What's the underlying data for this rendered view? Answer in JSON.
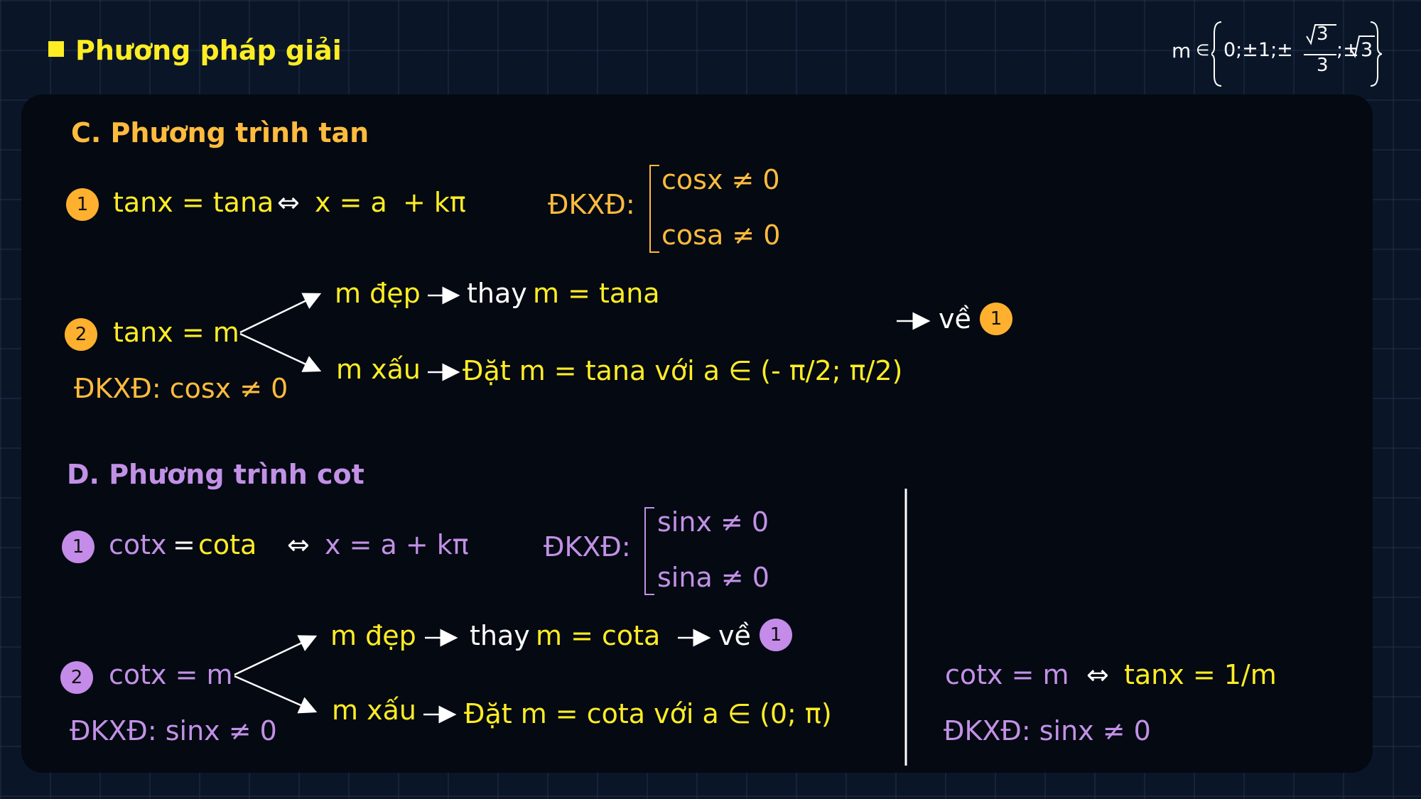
{
  "header": {
    "title": "Phương pháp giải",
    "m_set": {
      "m": "m",
      "in": "∈",
      "lead": "0;±1;±",
      "sqrt3": "3",
      "denom": "3",
      "tail": ";±",
      "sqrt3b": "3"
    }
  },
  "tan": {
    "heading": "C. Phương trình tan",
    "eq1": {
      "badge": "1",
      "lhs": "tanx = tana",
      "iff": "⇔",
      "x": "x = a",
      "k": "+ kπ"
    },
    "dk1": {
      "label": "ĐKXĐ:",
      "c1": "cosx ≠ 0",
      "c2": "cosa ≠ 0"
    },
    "eq2": {
      "badge": "2",
      "lhs": "tanx = m",
      "dk": "ĐKXĐ: cosx ≠ 0"
    },
    "nice": {
      "label": "m đẹp",
      "thay": "thay",
      "val": "m = tana"
    },
    "ugly": {
      "label": "m xấu",
      "text": "Đặt m = tana với a ∈ (- π/2; π/2)"
    },
    "back": {
      "text": "về",
      "badge": "1"
    }
  },
  "cot": {
    "heading": "D. Phương trình cot",
    "eq1": {
      "badge": "1",
      "lhs_fn": "cotx",
      "lhs_eq": "=",
      "lhs_rhs": "cota",
      "iff": "⇔",
      "x": "x = a + kπ"
    },
    "dk1": {
      "label": "ĐKXĐ:",
      "c1": "sinx ≠ 0",
      "c2": "sina ≠ 0"
    },
    "eq2": {
      "badge": "2",
      "lhs": "cotx = m",
      "dk": "ĐKXĐ: sinx ≠ 0"
    },
    "nice": {
      "label": "m đẹp",
      "thay": "thay",
      "val": "m = cota",
      "back": "về",
      "badge": "1"
    },
    "ugly": {
      "label": "m xấu",
      "text": "Đặt m = cota với a ∈ (0; π)"
    },
    "side": {
      "lhs": "cotx = m",
      "iff": "⇔",
      "rhs": "tanx = 1/m",
      "dk": "ĐKXĐ: sinx ≠ 0"
    }
  },
  "colors": {
    "yellow": "#ffed24",
    "orange": "#ffbb3d",
    "purple": "#c291e6",
    "background": "#0a1628",
    "panel": "#040912"
  }
}
